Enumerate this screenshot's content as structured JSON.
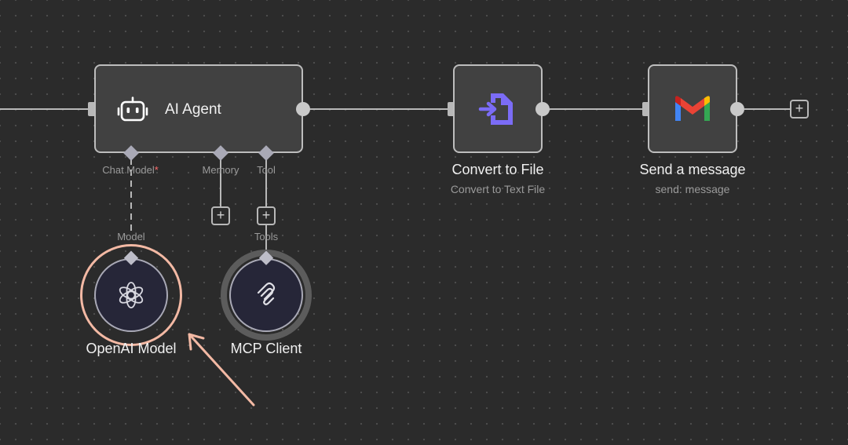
{
  "nodes": {
    "ai_agent": {
      "title": "AI Agent",
      "ports": {
        "chat_model": "Chat Model",
        "memory": "Memory",
        "tool": "Tool"
      }
    },
    "convert": {
      "title": "Convert to File",
      "subtitle": "Convert to Text File"
    },
    "gmail": {
      "title": "Send a message",
      "subtitle": "send: message"
    }
  },
  "subnodes": {
    "openai": {
      "title": "OpenAI Model",
      "port_label": "Model"
    },
    "mcp": {
      "title": "MCP Client",
      "port_label": "Tools"
    }
  },
  "plus_symbol": "+",
  "required_marker": "*",
  "colors": {
    "canvas": "#2b2b2b",
    "node_fill": "#414141",
    "node_border": "#bdbdbd",
    "wire": "#b8b8b8",
    "subnode_fill": "#262638",
    "selection": "#f3b9a4",
    "convert_icon": "#7b6cf6",
    "required": "#ff6b6b"
  },
  "icons": {
    "ai_agent": "robot-icon",
    "convert": "convert-file-icon",
    "gmail": "gmail-icon",
    "openai": "openai-icon",
    "mcp": "mcp-icon",
    "annotation": "pointer-arrow"
  }
}
